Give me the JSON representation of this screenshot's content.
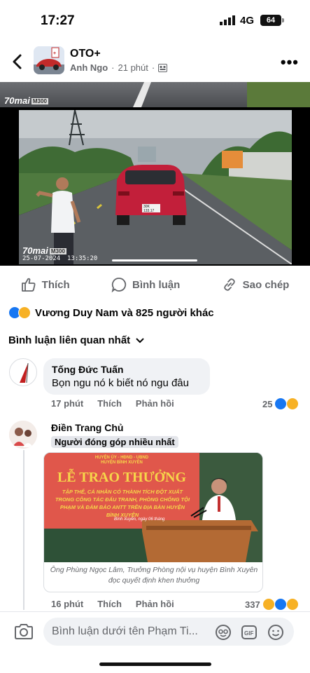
{
  "status_bar": {
    "time": "17:27",
    "network": "4G",
    "battery": "64"
  },
  "post": {
    "group_name": "OTO+",
    "author": "Anh Ngo",
    "time": "21 phút",
    "video": {
      "brand": "70mai",
      "model": "M300",
      "date": "25-07-2024",
      "clock": "13:35:20",
      "plate": "30K 133.17"
    }
  },
  "actions": {
    "like": "Thích",
    "comment": "Bình luận",
    "copy": "Sao chép"
  },
  "reactions_summary": "Vương Duy Nam và 825 người khác",
  "sort_label": "Bình luận liên quan nhất",
  "comments": [
    {
      "author": "Tống Đức Tuấn",
      "text": "Bọn ngu nó k biết nó ngu đâu",
      "time": "17 phút",
      "like": "Thích",
      "reply": "Phản hồi",
      "reaction_count": "25"
    },
    {
      "author": "Điền Trang Chủ",
      "badge": "Người đóng góp nhiều nhất",
      "photo_banner_small": "HUYỆN ỦY - HĐND - UBND",
      "photo_banner_small2": "HUYỆN BÌNH XUYÊN",
      "photo_banner_title": "LỄ TRAO THƯỞNG",
      "photo_banner_body": "TẬP THỂ, CÁ NHÂN CÓ THÀNH TÍCH ĐỘT XUẤT TRONG CÔNG TÁC ĐẤU TRANH, PHÒNG CHỐNG TỘI PHẠM VÀ ĐẢM BẢO ANTT TRÊN ĐỊA BÀN HUYỆN BÌNH XUYÊN",
      "photo_banner_date": "Bình Xuyên, ngày 06 tháng",
      "caption": "Ông Phùng Ngọc Lâm, Trưởng Phòng nội vụ huyện Bình Xuyên đọc quyết định khen thưởng",
      "time": "16 phút",
      "like": "Thích",
      "reply": "Phản hồi",
      "reaction_count": "337"
    }
  ],
  "composer": {
    "placeholder": "Bình luận dưới tên Phạm Ti..."
  },
  "colors": {
    "accent": "#1877f2",
    "muted": "#65676b",
    "bubble": "#f0f2f5",
    "banner_red": "#e0574b"
  }
}
